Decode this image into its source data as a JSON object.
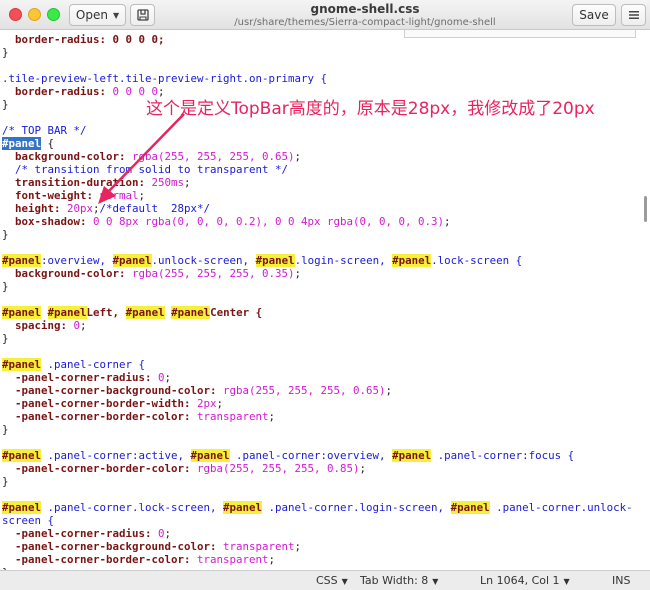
{
  "window": {
    "title": "gnome-shell.css",
    "subtitle": "/usr/share/themes/Sierra-compact-light/gnome-shell",
    "open_label": "Open",
    "save_label": "Save"
  },
  "editor": {
    "lines": [
      [
        {
          "t": "  border-radius: 0 0 0 0;",
          "c": "c-prop"
        }
      ],
      [
        {
          "t": "}",
          "c": ""
        }
      ],
      [
        {
          "t": "",
          "c": ""
        }
      ],
      [
        {
          "t": ".tile-preview-left.tile-preview-right.on-primary {",
          "c": "c-cls"
        }
      ],
      [
        {
          "t": "  border-radius: ",
          "c": "c-prop"
        },
        {
          "t": "0 0 0 0",
          "c": "c-num"
        },
        {
          "t": ";",
          "c": ""
        }
      ],
      [
        {
          "t": "}",
          "c": ""
        }
      ],
      [
        {
          "t": "",
          "c": ""
        }
      ],
      [
        {
          "t": "/* TOP BAR */",
          "c": "c-comment"
        }
      ],
      [
        {
          "t": "#panel",
          "c": "c-cur"
        },
        {
          "t": " {",
          "c": ""
        }
      ],
      [
        {
          "t": "  background-color: ",
          "c": "c-prop"
        },
        {
          "t": "rgba(255, 255, 255, 0.65)",
          "c": "c-val"
        },
        {
          "t": ";",
          "c": ""
        }
      ],
      [
        {
          "t": "  /* transition from solid to transparent */",
          "c": "c-comment"
        }
      ],
      [
        {
          "t": "  transition-duration: ",
          "c": "c-prop"
        },
        {
          "t": "250ms",
          "c": "c-val"
        },
        {
          "t": ";",
          "c": ""
        }
      ],
      [
        {
          "t": "  font-weight: ",
          "c": "c-prop"
        },
        {
          "t": "normal",
          "c": "c-val"
        },
        {
          "t": ";",
          "c": ""
        }
      ],
      [
        {
          "t": "  height: ",
          "c": "c-prop"
        },
        {
          "t": "20px",
          "c": "c-val"
        },
        {
          "t": ";",
          "c": ""
        },
        {
          "t": "/*default  28px*/",
          "c": "c-comment"
        }
      ],
      [
        {
          "t": "  box-shadow: ",
          "c": "c-prop"
        },
        {
          "t": "0 0 8px rgba(0, 0, 0, 0.2), 0 0 4px rgba(0, 0, 0, 0.3)",
          "c": "c-val"
        },
        {
          "t": ";",
          "c": ""
        }
      ],
      [
        {
          "t": "}",
          "c": ""
        }
      ],
      [
        {
          "t": "",
          "c": ""
        }
      ],
      [
        {
          "t": "#panel",
          "c": "c-hl"
        },
        {
          "t": ":overview, ",
          "c": "c-cls"
        },
        {
          "t": "#panel",
          "c": "c-hl"
        },
        {
          "t": ".unlock-screen, ",
          "c": "c-cls"
        },
        {
          "t": "#panel",
          "c": "c-hl"
        },
        {
          "t": ".login-screen, ",
          "c": "c-cls"
        },
        {
          "t": "#panel",
          "c": "c-hl"
        },
        {
          "t": ".lock-screen {",
          "c": "c-cls"
        }
      ],
      [
        {
          "t": "  background-color: ",
          "c": "c-prop"
        },
        {
          "t": "rgba(255, 255, 255, 0.35)",
          "c": "c-val"
        },
        {
          "t": ";",
          "c": ""
        }
      ],
      [
        {
          "t": "}",
          "c": ""
        }
      ],
      [
        {
          "t": "",
          "c": ""
        }
      ],
      [
        {
          "t": "#panel",
          "c": "c-hl"
        },
        {
          "t": " ",
          "c": ""
        },
        {
          "t": "#panel",
          "c": "c-hl"
        },
        {
          "t": "Left, ",
          "c": "c-prop"
        },
        {
          "t": "#panel",
          "c": "c-hl"
        },
        {
          "t": " ",
          "c": ""
        },
        {
          "t": "#panel",
          "c": "c-hl"
        },
        {
          "t": "Center {",
          "c": "c-prop"
        }
      ],
      [
        {
          "t": "  spacing: ",
          "c": "c-prop"
        },
        {
          "t": "0",
          "c": "c-num"
        },
        {
          "t": ";",
          "c": ""
        }
      ],
      [
        {
          "t": "}",
          "c": ""
        }
      ],
      [
        {
          "t": "",
          "c": ""
        }
      ],
      [
        {
          "t": "#panel",
          "c": "c-hl"
        },
        {
          "t": " .panel-corner {",
          "c": "c-cls"
        }
      ],
      [
        {
          "t": "  -panel-corner-radius: ",
          "c": "c-prop"
        },
        {
          "t": "0",
          "c": "c-num"
        },
        {
          "t": ";",
          "c": ""
        }
      ],
      [
        {
          "t": "  -panel-corner-background-color: ",
          "c": "c-prop"
        },
        {
          "t": "rgba(255, 255, 255, 0.65)",
          "c": "c-val"
        },
        {
          "t": ";",
          "c": ""
        }
      ],
      [
        {
          "t": "  -panel-corner-border-width: ",
          "c": "c-prop"
        },
        {
          "t": "2px",
          "c": "c-val"
        },
        {
          "t": ";",
          "c": ""
        }
      ],
      [
        {
          "t": "  -panel-corner-border-color: ",
          "c": "c-prop"
        },
        {
          "t": "transparent",
          "c": "c-val"
        },
        {
          "t": ";",
          "c": ""
        }
      ],
      [
        {
          "t": "}",
          "c": ""
        }
      ],
      [
        {
          "t": "",
          "c": ""
        }
      ],
      [
        {
          "t": "#panel",
          "c": "c-hl"
        },
        {
          "t": " .panel-corner:active, ",
          "c": "c-cls"
        },
        {
          "t": "#panel",
          "c": "c-hl"
        },
        {
          "t": " .panel-corner:overview, ",
          "c": "c-cls"
        },
        {
          "t": "#panel",
          "c": "c-hl"
        },
        {
          "t": " .panel-corner:focus {",
          "c": "c-cls"
        }
      ],
      [
        {
          "t": "  -panel-corner-border-color: ",
          "c": "c-prop"
        },
        {
          "t": "rgba(255, 255, 255, 0.85)",
          "c": "c-val"
        },
        {
          "t": ";",
          "c": ""
        }
      ],
      [
        {
          "t": "}",
          "c": ""
        }
      ],
      [
        {
          "t": "",
          "c": ""
        }
      ],
      [
        {
          "t": "#panel",
          "c": "c-hl"
        },
        {
          "t": " .panel-corner.lock-screen, ",
          "c": "c-cls"
        },
        {
          "t": "#panel",
          "c": "c-hl"
        },
        {
          "t": " .panel-corner.login-screen, ",
          "c": "c-cls"
        },
        {
          "t": "#panel",
          "c": "c-hl"
        },
        {
          "t": " .panel-corner.unlock-",
          "c": "c-cls"
        }
      ],
      [
        {
          "t": "screen {",
          "c": "c-cls"
        }
      ],
      [
        {
          "t": "  -panel-corner-radius: ",
          "c": "c-prop"
        },
        {
          "t": "0",
          "c": "c-num"
        },
        {
          "t": ";",
          "c": ""
        }
      ],
      [
        {
          "t": "  -panel-corner-background-color: ",
          "c": "c-prop"
        },
        {
          "t": "transparent",
          "c": "c-val"
        },
        {
          "t": ";",
          "c": ""
        }
      ],
      [
        {
          "t": "  -panel-corner-border-color: ",
          "c": "c-prop"
        },
        {
          "t": "transparent",
          "c": "c-val"
        },
        {
          "t": ";",
          "c": ""
        }
      ],
      [
        {
          "t": "}",
          "c": ""
        }
      ]
    ]
  },
  "annotation": {
    "text": "这个是定义TopBar高度的，原本是28px，我修改成了20px",
    "color": "#e8245e"
  },
  "statusbar": {
    "language": "CSS",
    "tab_width": "Tab Width: 8",
    "position": "Ln 1064, Col 1",
    "mode": "INS"
  },
  "icons": {
    "new_document": "new-document-icon",
    "menu": "hamburger-menu-icon",
    "dropdown": "chevron-down-icon"
  }
}
